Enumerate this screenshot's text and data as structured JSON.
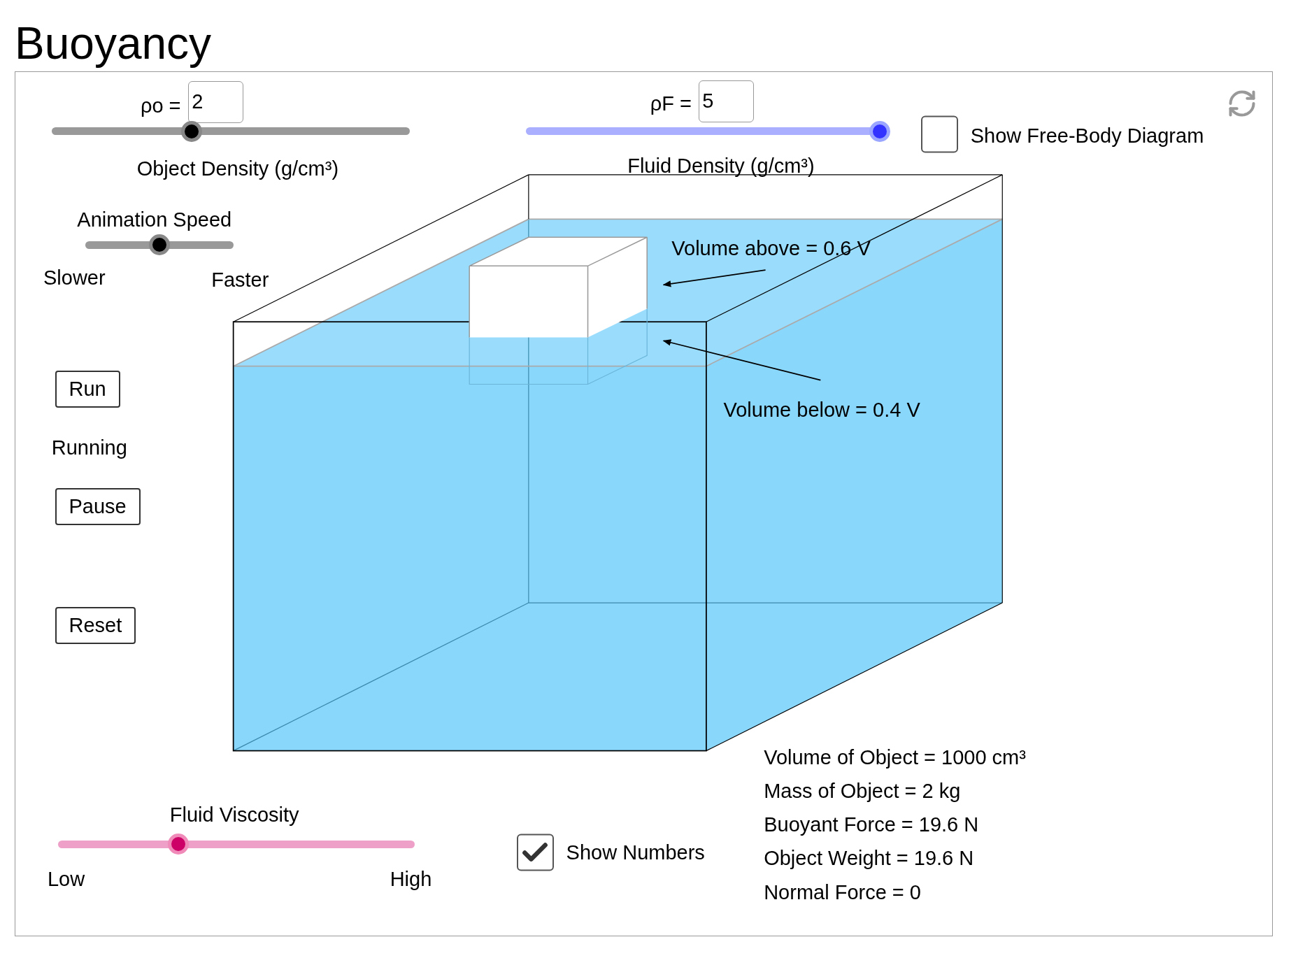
{
  "title": "Buoyancy",
  "object_density": {
    "symbol": "ρo =",
    "value": "2",
    "label": "Object Density (g/cm³)",
    "level": 0.39
  },
  "fluid_density": {
    "symbol": "ρF =",
    "value": "5",
    "label": "Fluid Density (g/cm³)",
    "level": 1
  },
  "free_body_checkbox": {
    "label": "Show Free-Body Diagram",
    "checked": false
  },
  "animation_speed": {
    "label": "Animation Speed",
    "min_label": "Slower",
    "max_label": "Faster",
    "level": 0.5
  },
  "buttons": [
    {
      "label": "Run"
    },
    {
      "label": "Pause"
    },
    {
      "label": "Reset"
    }
  ],
  "status": "Running",
  "tank": {
    "volume_above": "Volume above = 0.6 V",
    "volume_below": "Volume below = 0.4 V"
  },
  "readouts": [
    "Volume of Object = 1000 cm³",
    "Mass of Object = 2 kg",
    "Buoyant Force = 19.6 N",
    "Object Weight = 19.6 N",
    "Normal Force = 0"
  ],
  "viscosity": {
    "label": "Fluid Viscosity",
    "min_label": "Low",
    "max_label": "High",
    "level": 0.337
  },
  "numbers_checkbox": {
    "label": "Show Numbers",
    "checked": true
  }
}
